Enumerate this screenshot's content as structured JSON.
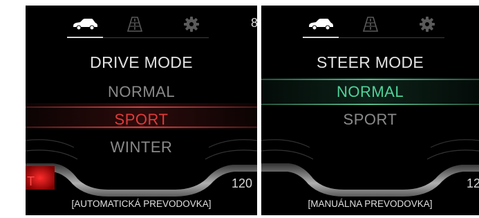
{
  "screens": [
    {
      "tabs": [
        {
          "icon": "car-icon",
          "active": true
        },
        {
          "icon": "road-icon",
          "active": false
        },
        {
          "icon": "gear-icon",
          "active": false
        }
      ],
      "corner_top_right": "8",
      "title": "DRIVE MODE",
      "options": [
        {
          "label": "NORMAL",
          "selected": false
        },
        {
          "label": "SPORT",
          "selected": true
        },
        {
          "label": "WINTER",
          "selected": false
        }
      ],
      "gauge_left_fragment": "T",
      "gauge_right_value": "120",
      "footer": "[AUTOMATICKÁ PREVODOVKA]",
      "highlight_color": "#e23a3a"
    },
    {
      "tabs": [
        {
          "icon": "car-icon",
          "active": true
        },
        {
          "icon": "road-icon",
          "active": false
        },
        {
          "icon": "gear-icon",
          "active": false
        }
      ],
      "title": "STEER MODE",
      "options": [
        {
          "label": "NORMAL",
          "selected": true
        },
        {
          "label": "SPORT",
          "selected": false
        }
      ],
      "gauge_right_value": "12",
      "footer": "[MANUÁLNA PREVODOVKA]",
      "highlight_color": "#4fd39a"
    }
  ],
  "colors": {
    "background": "#000000",
    "text_active": "#e2e2e2",
    "text_inactive": "#8a8a8a",
    "drive_highlight": "#e23a3a",
    "steer_highlight": "#4fd39a"
  }
}
